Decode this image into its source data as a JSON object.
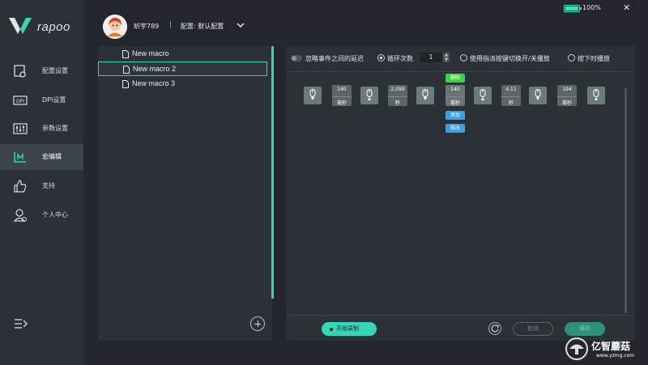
{
  "brand": {
    "name": "rapoo"
  },
  "colors": {
    "accent": "#35d6b8",
    "delete": "#39d43f",
    "add": "#3aa0e0"
  },
  "sidebar": {
    "items": [
      {
        "label": "配置设置",
        "icon": "profile-settings-icon"
      },
      {
        "label": "DPI设置",
        "icon": "dpi-icon"
      },
      {
        "label": "参数设置",
        "icon": "sliders-icon"
      },
      {
        "label": "宏编辑",
        "icon": "macro-icon",
        "active": true
      },
      {
        "label": "支持",
        "icon": "thumbs-up-icon"
      },
      {
        "label": "个人中心",
        "icon": "user-icon"
      }
    ]
  },
  "header": {
    "username": "昕宇789",
    "separator": "|",
    "config": "配置: 默认配置",
    "battery": "100%",
    "close": "✕"
  },
  "macros": {
    "items": [
      "New macro",
      "New macro 2",
      "New macro 3"
    ],
    "selected_index": 1
  },
  "toolbar": {
    "ignore_delay": "忽略事件之间的延迟",
    "loop_label": "循环次数",
    "loop_count": "1",
    "toggle_mode": "使用指派按键切换开/关播放",
    "hold_mode": "按下时播放"
  },
  "events": {
    "delays": [
      {
        "value": "140",
        "unit": "毫秒"
      },
      {
        "value": "2.099",
        "unit": "秒"
      },
      {
        "value": "140",
        "unit": "毫秒"
      },
      {
        "value": "4.11",
        "unit": "秒"
      },
      {
        "value": "194",
        "unit": "毫秒"
      }
    ],
    "actions": {
      "delete": "删除",
      "add": "添加",
      "modify": "修改"
    }
  },
  "bottom": {
    "record": "开始录制",
    "cancel": "取消",
    "save": "保存"
  },
  "watermark": {
    "title": "亿智蘑菇",
    "url": "www.yzmg.com"
  }
}
